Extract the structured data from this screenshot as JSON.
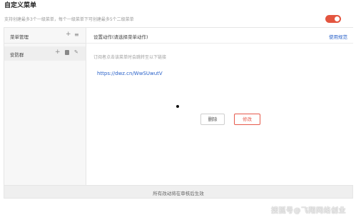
{
  "page": {
    "title": "自定义菜单",
    "hint": "支持创建最多3个一级菜单，每个一级菜单下可创建最多5个二级菜单",
    "toggle_state": "on"
  },
  "sidebar": {
    "header_label": "菜单管理",
    "items": [
      {
        "label": "安防群"
      }
    ]
  },
  "content": {
    "header_title": "设置动作(请选择菜单动作)",
    "header_link": "使用规范",
    "description": "订阅者点击该菜单时会跳转至以下链接",
    "url": "https://dwz.cn/WwSUwutV",
    "delete_label": "删除",
    "edit_label": "修改"
  },
  "footer": {
    "text": "所有改动将在审核后生效"
  },
  "watermark": {
    "text": "搜狐号@飞翔网络创业"
  },
  "colors": {
    "accent": "#e3553f",
    "link": "#2a62c9",
    "edit_border": "#e65a4c"
  },
  "icons": [
    "plus-icon",
    "sort-icon",
    "trash-icon",
    "pencil-icon"
  ]
}
